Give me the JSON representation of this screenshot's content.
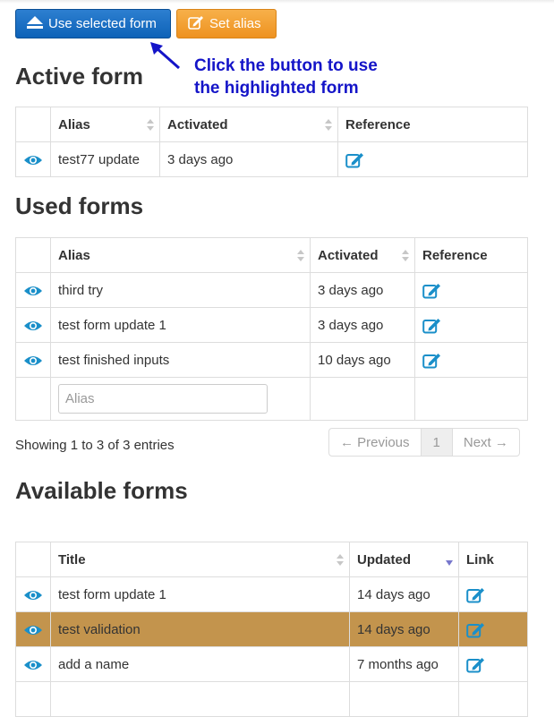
{
  "toolbar": {
    "use_label": "Use selected form",
    "alias_label": "Set alias",
    "primary_color": "#0d62b8",
    "warning_color": "#ee9220"
  },
  "callout": {
    "line1": "Click the button to use",
    "line2": "the highlighted form",
    "color": "#1414c8"
  },
  "active": {
    "title": "Active form",
    "headers": [
      "Alias",
      "Activated",
      "Reference"
    ],
    "rows": [
      {
        "alias": "test77 update",
        "activated": "3 days ago"
      }
    ]
  },
  "used": {
    "title": "Used forms",
    "headers": [
      "Alias",
      "Activated",
      "Reference"
    ],
    "rows": [
      {
        "alias": "third try",
        "activated": "3 days ago"
      },
      {
        "alias": "test form update 1",
        "activated": "3 days ago"
      },
      {
        "alias": "test finished inputs",
        "activated": "10 days ago"
      }
    ],
    "filter_placeholder": "Alias",
    "info": "Showing 1 to 3 of 3 entries",
    "pagination": {
      "prev": "← Previous",
      "current": "1",
      "next": "Next →"
    }
  },
  "available": {
    "title": "Available forms",
    "headers": [
      "Title",
      "Updated",
      "Link"
    ],
    "rows": [
      {
        "title": "test form update 1",
        "updated": "14 days ago",
        "selected": false
      },
      {
        "title": "test validation",
        "updated": "14 days ago",
        "selected": true
      },
      {
        "title": "add a name",
        "updated": "7 months ago",
        "selected": false
      }
    ],
    "highlight_color": "#c3944d"
  },
  "icons": {
    "view": "eye-icon",
    "edit": "edit-icon",
    "use": "eject-icon",
    "alias": "edit-icon"
  },
  "accent_color": "#1a8fc9"
}
